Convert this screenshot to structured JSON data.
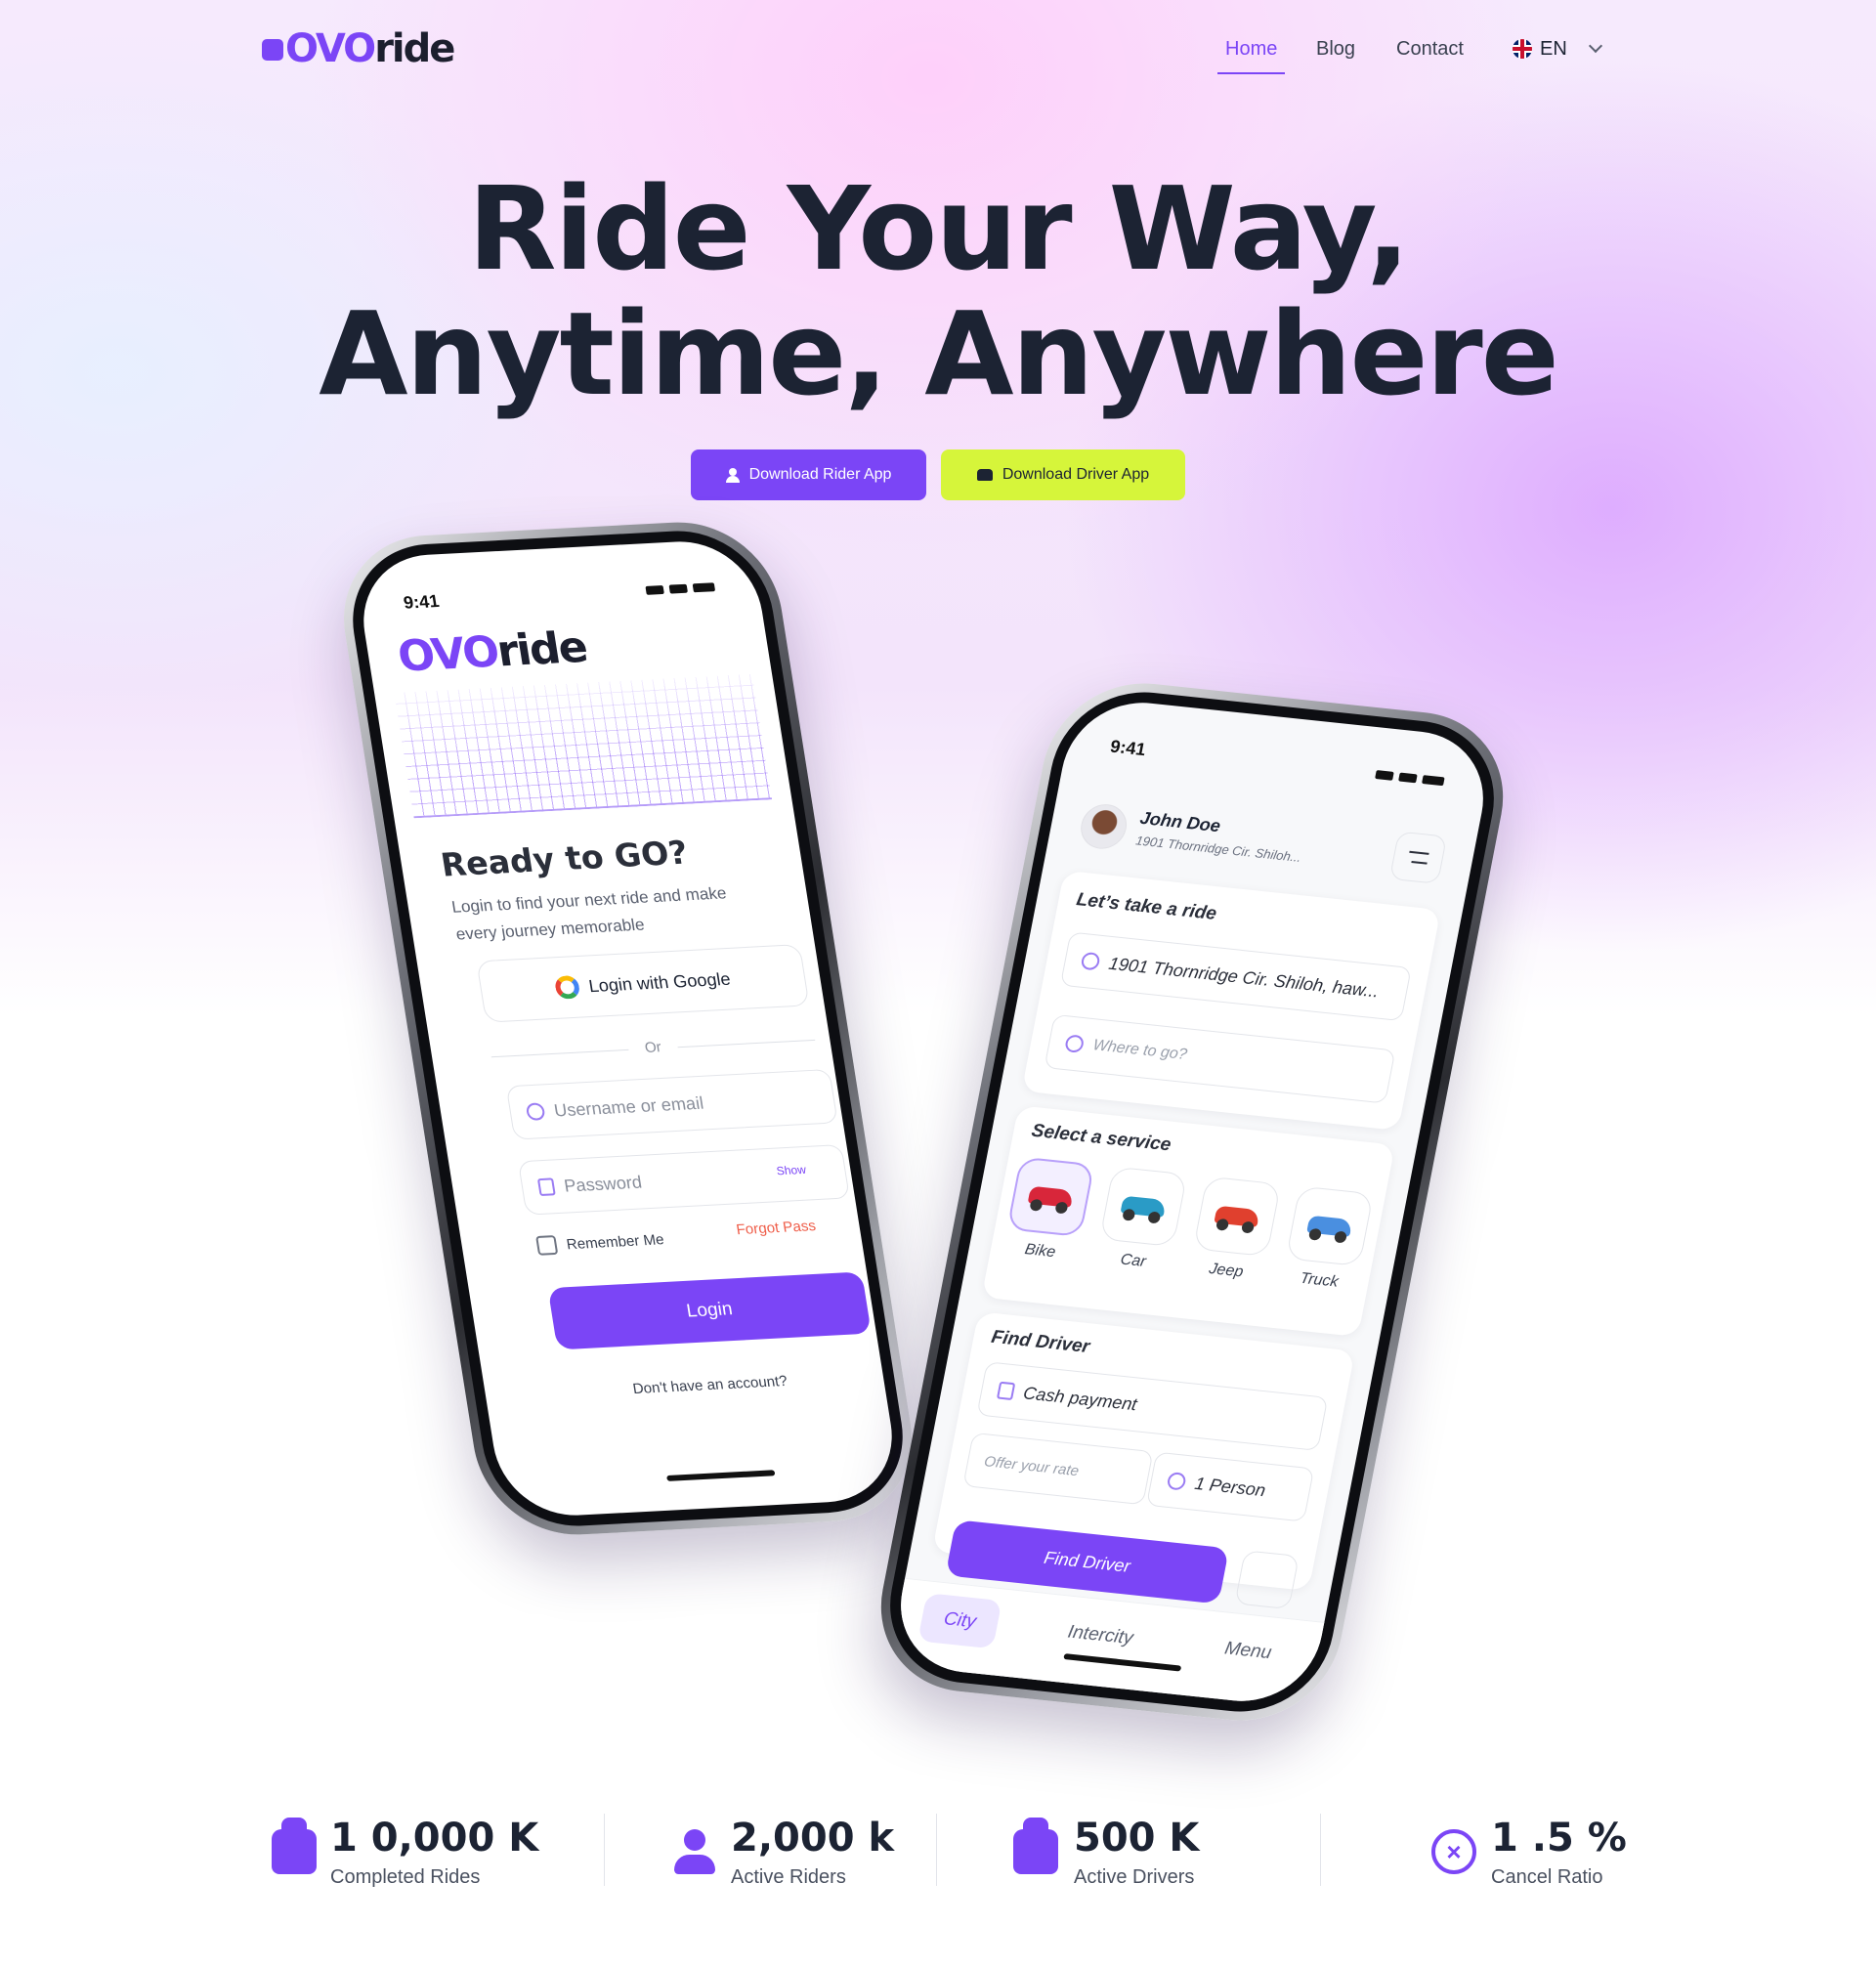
{
  "brand": {
    "logo_part1": "OVO",
    "logo_part2": "ride",
    "accent": "#7b45f6",
    "lime": "#d6f53a"
  },
  "nav": {
    "items": [
      {
        "label": "Home",
        "active": true
      },
      {
        "label": "Blog"
      },
      {
        "label": "Contact"
      }
    ],
    "language": {
      "label": "EN",
      "icon": "uk-flag-icon"
    }
  },
  "hero": {
    "title_line1": "Ride Your Way,",
    "title_line2": "Anytime, Anywhere",
    "rider_button": "Download Rider App",
    "driver_button": "Download Driver App"
  },
  "phone_login": {
    "time": "9:41",
    "logo_part1": "OVO",
    "logo_part2": "ride",
    "heading": "Ready to GO?",
    "subtext": "Login to find your next ride and make every journey memorable",
    "google_button": "Login with Google",
    "divider": "Or",
    "username_placeholder": "Username or email",
    "password_placeholder": "Password",
    "show_label": "Show",
    "remember_label": "Remember Me",
    "forgot_label": "Forgot Pass",
    "login_button": "Login",
    "account_text": "Don't have an account?"
  },
  "phone_ride": {
    "time": "9:41",
    "user_name": "John Doe",
    "user_address": "1901 Thornridge Cir. Shiloh...",
    "ride_heading": "Let’s take a ride",
    "pickup_value": "1901 Thornridge Cir. Shiloh, haw...",
    "destination_placeholder": "Where to go?",
    "service_heading": "Select a service",
    "services": [
      {
        "label": "Bike",
        "selected": true,
        "color": "#d8263a"
      },
      {
        "label": "Car",
        "color": "#2a9bc6"
      },
      {
        "label": "Jeep",
        "color": "#e0402e"
      },
      {
        "label": "Truck",
        "color": "#4a8fe0"
      }
    ],
    "find_heading": "Find Driver",
    "payment_value": "Cash payment",
    "rate_placeholder": "Offer your rate",
    "person_value": "1 Person",
    "find_button": "Find Driver",
    "tabs": [
      {
        "label": "City",
        "active": true
      },
      {
        "label": "Intercity"
      },
      {
        "label": "Menu"
      }
    ]
  },
  "stats": [
    {
      "value": "1 0,000 K",
      "label": "Completed Rides",
      "icon": "taxi-icon"
    },
    {
      "value": "2,000 k",
      "label": "Active Riders",
      "icon": "rider-icon"
    },
    {
      "value": "500 K",
      "label": "Active Drivers",
      "icon": "taxi-icon"
    },
    {
      "value": "1 .5 %",
      "label": "Cancel Ratio",
      "icon": "cancel-icon"
    }
  ]
}
